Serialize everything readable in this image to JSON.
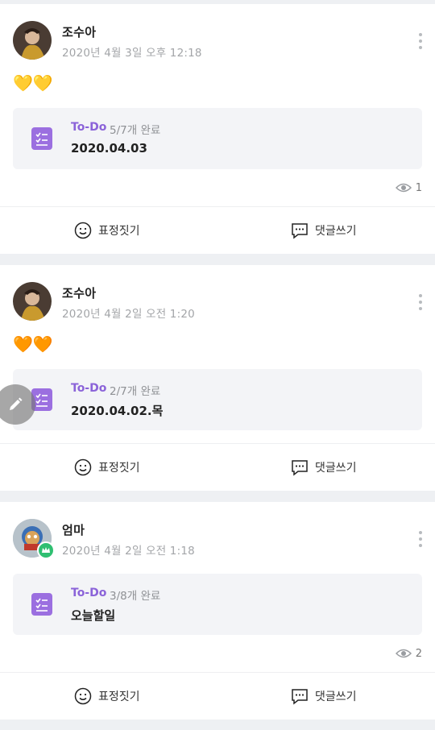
{
  "posts": [
    {
      "author": "조수아",
      "timestamp": "2020년 4월 3일 오후 12:18",
      "emoji": "💛💛",
      "todo": {
        "kind": "To-Do",
        "progress": "5/7개 완료",
        "title": "2020.04.03"
      },
      "views": "1",
      "actions": {
        "reaction": "표정짓기",
        "comment": "댓글쓰기"
      }
    },
    {
      "author": "조수아",
      "timestamp": "2020년 4월 2일 오전 1:20",
      "emoji": "🧡🧡",
      "todo": {
        "kind": "To-Do",
        "progress": "2/7개 완료",
        "title": "2020.04.02.목"
      },
      "actions": {
        "reaction": "표정짓기",
        "comment": "댓글쓰기"
      }
    },
    {
      "author": "엄마",
      "timestamp": "2020년 4월 2일 오전 1:18",
      "todo": {
        "kind": "To-Do",
        "progress": "3/8개 완료",
        "title": "오늘할일"
      },
      "views": "2",
      "actions": {
        "reaction": "표정짓기",
        "comment": "댓글쓰기"
      }
    }
  ],
  "colors": {
    "accent": "#8b63d9",
    "icon_purple": "#9b6fe0",
    "owner_badge": "#2fbf71"
  },
  "icons": [
    "more-vertical-icon",
    "todo-list-icon",
    "eye-icon",
    "smile-icon",
    "comment-icon",
    "pencil-icon",
    "crown-icon"
  ]
}
